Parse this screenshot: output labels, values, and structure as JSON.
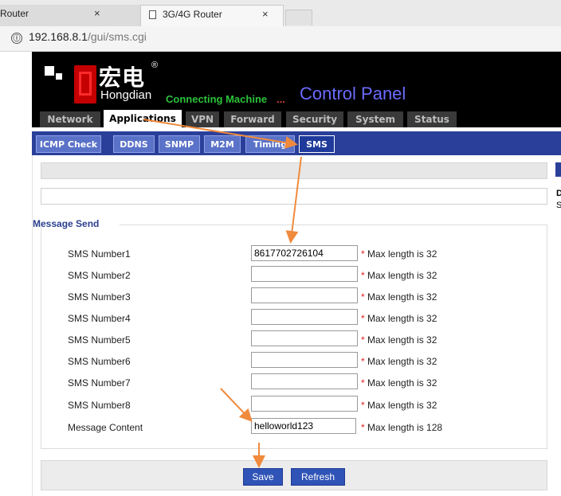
{
  "browser": {
    "tabs": [
      {
        "title": "Router",
        "close": "×"
      },
      {
        "title": "3G/4G Router",
        "close": "×"
      }
    ],
    "address": {
      "host": "192.168.8.1",
      "path": "/gui/sms.cgi",
      "info_icon": "ⓘ"
    }
  },
  "header": {
    "brand_cn": "宏电",
    "brand_reg": "®",
    "brand_en": "Hongdian",
    "tagline": "Connecting Machine",
    "tagline_dots": "...",
    "title": "Control Panel"
  },
  "main_nav": [
    "Network",
    "Applications",
    "VPN",
    "Forward",
    "Security",
    "System",
    "Status"
  ],
  "sub_nav": [
    "ICMP Check",
    "DDNS",
    "SNMP",
    "M2M",
    "Timing",
    "SMS"
  ],
  "side": {
    "d": "D",
    "s": "S"
  },
  "form": {
    "legend": "Message Send",
    "rows": [
      {
        "label": "SMS Number1",
        "value": "8617702726104",
        "hint": "Max length is 32"
      },
      {
        "label": "SMS Number2",
        "value": "",
        "hint": "Max length is 32"
      },
      {
        "label": "SMS Number3",
        "value": "",
        "hint": "Max length is 32"
      },
      {
        "label": "SMS Number4",
        "value": "",
        "hint": "Max length is 32"
      },
      {
        "label": "SMS Number5",
        "value": "",
        "hint": "Max length is 32"
      },
      {
        "label": "SMS Number6",
        "value": "",
        "hint": "Max length is 32"
      },
      {
        "label": "SMS Number7",
        "value": "",
        "hint": "Max length is 32"
      },
      {
        "label": "SMS Number8",
        "value": "",
        "hint": "Max length is 32"
      },
      {
        "label": "Message Content",
        "value": "helloworld123",
        "hint": "Max length is 128"
      }
    ],
    "required_mark": "*"
  },
  "buttons": {
    "save": "Save",
    "refresh": "Refresh"
  },
  "colors": {
    "accent": "#2a3f9a",
    "button": "#2f53b6",
    "annotation_arrow": "#f08a3c",
    "required": "#e02020"
  }
}
